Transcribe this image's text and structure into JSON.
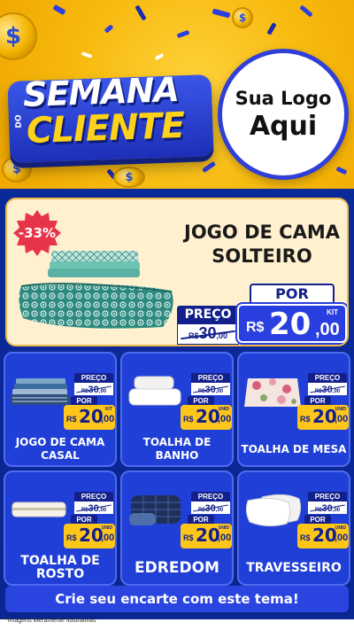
{
  "header": {
    "headline_top": "SEMANA",
    "headline_small": "DO",
    "headline_bottom": "CLIENTE",
    "logo_line1": "Sua Logo",
    "logo_line2": "Aqui",
    "coin_symbol": "$"
  },
  "featured": {
    "discount": "-33%",
    "title": "JOGO DE CAMA SOLTEIRO",
    "preco_label": "PREÇO",
    "old_currency": "R$",
    "old_value": "30",
    "old_cents": ",00",
    "por_label": "POR",
    "unit": "KIT",
    "currency": "R$",
    "price_int": "20",
    "price_dec": ",00"
  },
  "cards": [
    {
      "name": "JOGO DE CAMA CASAL",
      "preco_label": "PREÇO",
      "old_currency": "R$",
      "old_value": "30",
      "old_cents": ",00",
      "por_label": "POR",
      "unit": "KIT",
      "currency": "R$",
      "price_int": "20",
      "price_dec": ",00"
    },
    {
      "name": "TOALHA DE BANHO",
      "preco_label": "PREÇO",
      "old_currency": "R$",
      "old_value": "30",
      "old_cents": ",00",
      "por_label": "POR",
      "unit": "UNID",
      "currency": "R$",
      "price_int": "20",
      "price_dec": ",00"
    },
    {
      "name": "TOALHA DE MESA",
      "preco_label": "PREÇO",
      "old_currency": "R$",
      "old_value": "30",
      "old_cents": ",00",
      "por_label": "POR",
      "unit": "UNID",
      "currency": "R$",
      "price_int": "20",
      "price_dec": ",00"
    },
    {
      "name": "TOALHA DE ROSTO",
      "preco_label": "PREÇO",
      "old_currency": "R$",
      "old_value": "30",
      "old_cents": ",00",
      "por_label": "POR",
      "unit": "UNID",
      "currency": "R$",
      "price_int": "20",
      "price_dec": ",00"
    },
    {
      "name": "EDREDOM",
      "preco_label": "PREÇO",
      "old_currency": "R$",
      "old_value": "30",
      "old_cents": ",00",
      "por_label": "POR",
      "unit": "UNID",
      "currency": "R$",
      "price_int": "20",
      "price_dec": ",00"
    },
    {
      "name": "TRAVESSEIRO",
      "preco_label": "PREÇO",
      "old_currency": "R$",
      "old_value": "30",
      "old_cents": ",00",
      "por_label": "POR",
      "unit": "UNID",
      "currency": "R$",
      "price_int": "20",
      "price_dec": ",00"
    }
  ],
  "cta": "Crie seu encarte com este tema!",
  "disclaimer": "*Imagens Meramente Ilustrativas",
  "colors": {
    "header_yellow": "#f7b90d",
    "main_blue": "#0b2a9a",
    "card_blue": "#1f3fd6",
    "price_yellow": "#ffc61a",
    "discount_red": "#e8344a",
    "featured_bg": "#fff1cf"
  },
  "icons": [
    "dollar-coin-icon",
    "confetti-decoration"
  ]
}
